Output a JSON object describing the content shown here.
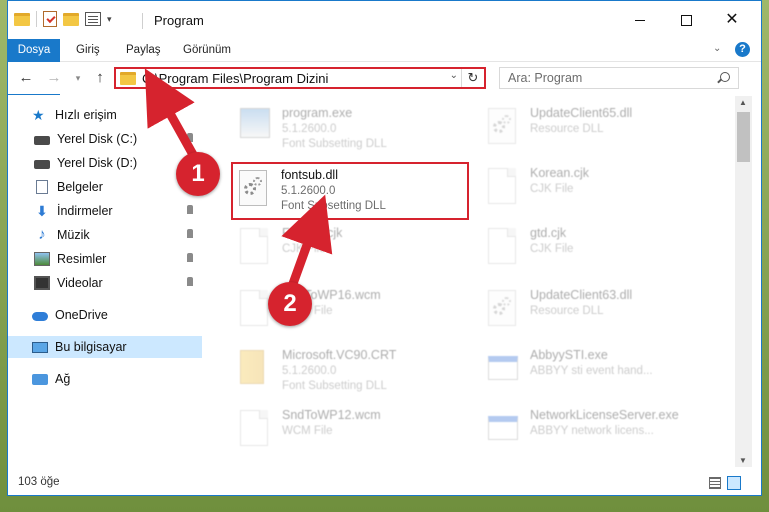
{
  "window": {
    "title": "Program",
    "buttons": {
      "minimize": "minimize",
      "maximize": "maximize",
      "close": "✕"
    }
  },
  "ribbon": {
    "tabs": [
      "Dosya",
      "Giriş",
      "Paylaş",
      "Görünüm"
    ],
    "help": "?"
  },
  "nav": {
    "address": "C:\\Program Files\\Program Dizini",
    "search_placeholder": "Ara: Program"
  },
  "sidebar": {
    "items": [
      {
        "label": "Hızlı erişim",
        "icon": "star-icon"
      },
      {
        "label": "Yerel Disk (C:)",
        "icon": "drive-icon",
        "pinned": true
      },
      {
        "label": "Yerel Disk (D:)",
        "icon": "drive-icon",
        "pinned": true
      },
      {
        "label": "Belgeler",
        "icon": "documents-icon",
        "pinned": true
      },
      {
        "label": "İndirmeler",
        "icon": "downloads-icon",
        "pinned": true
      },
      {
        "label": "Müzik",
        "icon": "music-icon",
        "pinned": true
      },
      {
        "label": "Resimler",
        "icon": "pictures-icon",
        "pinned": true
      },
      {
        "label": "Videolar",
        "icon": "videos-icon",
        "pinned": true
      },
      {
        "label": "OneDrive",
        "icon": "onedrive-icon"
      },
      {
        "label": "Bu bilgisayar",
        "icon": "computer-icon",
        "selected": true
      },
      {
        "label": "Ağ",
        "icon": "network-icon"
      }
    ]
  },
  "files": {
    "highlighted": {
      "name": "fontsub.dll",
      "version": "5.1.2600.0",
      "desc": "Font Subsetting DLL"
    },
    "left": [
      {
        "name": "program.exe",
        "line1": "5.1.2600.0",
        "line2": "Font Subsetting DLL"
      },
      {
        "name": "Fastem.cjk",
        "line1": "CJK File",
        "line2": ""
      },
      {
        "name": "SndToWP16.wcm",
        "line1": "WCM File",
        "line2": ""
      },
      {
        "name": "Microsoft.VC90.CRT",
        "line1": "5.1.2600.0",
        "line2": "Font Subsetting DLL"
      },
      {
        "name": "SndToWP12.wcm",
        "line1": "WCM File",
        "line2": ""
      }
    ],
    "right": [
      {
        "name": "UpdateClient65.dll",
        "line1": "Resource DLL",
        "line2": ""
      },
      {
        "name": "Korean.cjk",
        "line1": "CJK File",
        "line2": ""
      },
      {
        "name": "gtd.cjk",
        "line1": "CJK File",
        "line2": ""
      },
      {
        "name": "UpdateClient63.dll",
        "line1": "Resource DLL",
        "line2": ""
      },
      {
        "name": "AbbyySTI.exe",
        "line1": "ABBYY sti event hand...",
        "line2": ""
      },
      {
        "name": "NetworkLicenseServer.exe",
        "line1": "ABBYY network licens...",
        "line2": ""
      }
    ]
  },
  "status": {
    "count": "103 öğe"
  },
  "annotations": {
    "step1": "1",
    "step2": "2"
  },
  "colors": {
    "accent": "#1979ca",
    "highlight": "#d6232e"
  }
}
